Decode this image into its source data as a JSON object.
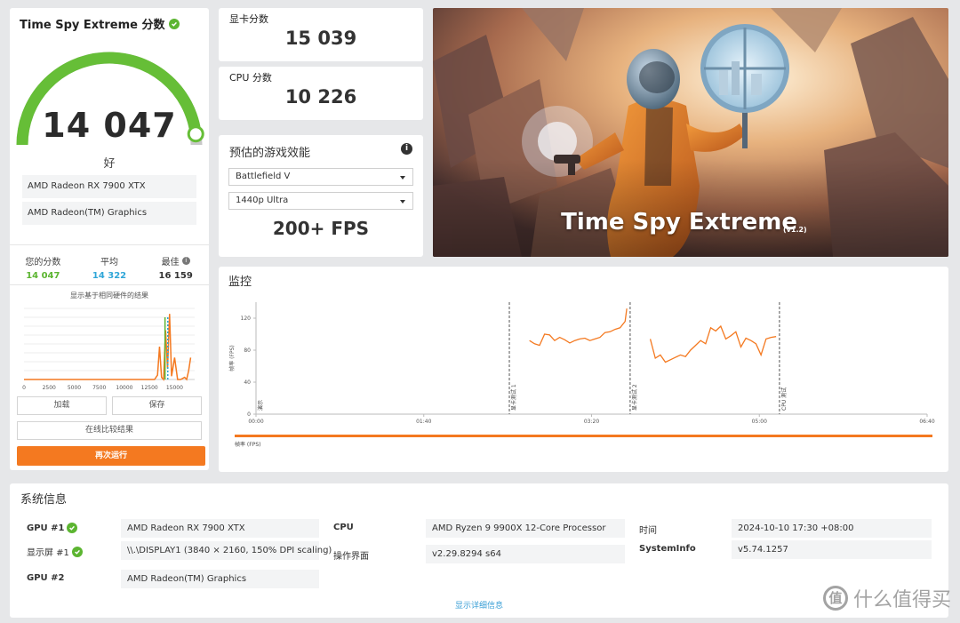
{
  "score_panel": {
    "title": "Time Spy Extreme 分数",
    "total_score": "14 047",
    "gauge_level": 0.96,
    "rating": "好",
    "gpu_primary": "AMD Radeon RX 7900 XTX",
    "gpu_secondary": "AMD Radeon(TM) Graphics",
    "stats": {
      "yours_label": "您的分数",
      "yours_value": "14 047",
      "avg_label": "平均",
      "avg_value": "14 322",
      "best_label": "最佳",
      "best_value": "16 159"
    },
    "dist_title": "显示基于相同硬件的结果",
    "buttons": {
      "load": "加载",
      "save": "保存",
      "compare": "在线比较结果",
      "rerun": "再次运行"
    },
    "colors": {
      "gauge_fill": "#66be37",
      "gauge_track": "#c8c8c8",
      "yours": "#5cb531",
      "avg": "#2fa6d8",
      "orange": "#f47920"
    }
  },
  "gpu_score": {
    "title": "显卡分数",
    "value": "15 039"
  },
  "cpu_score": {
    "title": "CPU 分数",
    "value": "10 226"
  },
  "game_perf": {
    "title": "预估的游戏效能",
    "game": "Battlefield V",
    "setting": "1440p Ultra",
    "fps": "200+ FPS"
  },
  "hero": {
    "title": "Time Spy Extreme",
    "version": "(v1.2)"
  },
  "monitor": {
    "title": "监控",
    "legend": "帧率 (FPS)"
  },
  "chart_data": [
    {
      "type": "area",
      "title": "",
      "xlabel": "",
      "ylabel": "",
      "x_ticks": [
        "0",
        "2500",
        "5000",
        "7500",
        "10000",
        "12500",
        "15000"
      ],
      "xlim": [
        0,
        17000
      ],
      "series": [
        {
          "x": [
            0,
            13000,
            13300,
            13500,
            13700,
            13900,
            14100,
            14300,
            14500,
            14700,
            15000,
            15300,
            15600,
            16000,
            16200,
            16400,
            16600
          ],
          "values": [
            0,
            0,
            4,
            30,
            2,
            0,
            45,
            10,
            60,
            3,
            20,
            0,
            0,
            2,
            0,
            8,
            20
          ]
        }
      ],
      "markers": {
        "yours": 14047,
        "average": 14322
      }
    },
    {
      "type": "line",
      "title": "",
      "xlabel": "",
      "ylabel": "帧率 (FPS)",
      "ylim": [
        0,
        140
      ],
      "y_ticks": [
        "0",
        "40",
        "80",
        "120"
      ],
      "x_ticks": [
        "00:00",
        "01:40",
        "03:20",
        "05:00",
        "06:40"
      ],
      "xlim_seconds": [
        0,
        400
      ],
      "phase_labels": [
        "演示",
        "显卡测试 1",
        "显卡测试 2",
        "CPU 测试"
      ],
      "phase_start_seconds": [
        0,
        151,
        223,
        312
      ],
      "series": [
        {
          "name": "帧率 (FPS)",
          "segments": [
            {
              "x": [
                163,
                166,
                169,
                172,
                175,
                178,
                181,
                184,
                187,
                190,
                193,
                196,
                199,
                202,
                205,
                208,
                211,
                214,
                217,
                220,
                221
              ],
              "y": [
                92,
                88,
                86,
                100,
                99,
                92,
                96,
                93,
                89,
                92,
                94,
                95,
                92,
                94,
                96,
                102,
                103,
                106,
                108,
                116,
                132
              ]
            },
            {
              "x": [
                235,
                238,
                241,
                244,
                247,
                250,
                253,
                256,
                259,
                262,
                265,
                268,
                271,
                274,
                277,
                280,
                283,
                286,
                289,
                292,
                295,
                298,
                301,
                304,
                307,
                310
              ],
              "y": [
                94,
                70,
                74,
                65,
                68,
                71,
                74,
                72,
                80,
                86,
                92,
                88,
                108,
                104,
                110,
                94,
                98,
                103,
                84,
                95,
                92,
                88,
                74,
                94,
                96,
                97
              ]
            }
          ]
        }
      ]
    }
  ],
  "system_info": {
    "title": "系统信息",
    "gpu1_label": "GPU #1",
    "gpu1_value": "AMD Radeon RX 7900 XTX",
    "display1_label": "显示屏 #1",
    "display1_value": "\\\\.\\DISPLAY1 (3840 × 2160, 150% DPI scaling)",
    "gpu2_label": "GPU #2",
    "gpu2_value": "AMD Radeon(TM) Graphics",
    "cpu_label": "CPU",
    "cpu_value": "AMD Ryzen 9 9900X 12-Core Processor",
    "ui_label": "操作界面",
    "ui_value": "v2.29.8294 s64",
    "time_label": "时间",
    "time_value": "2024-10-10 17:30 +08:00",
    "sysinfo_label": "SystemInfo",
    "sysinfo_value": "v5.74.1257",
    "detail_link": "显示详细信息"
  },
  "watermark": {
    "logo": "值",
    "text": "什么值得买"
  }
}
